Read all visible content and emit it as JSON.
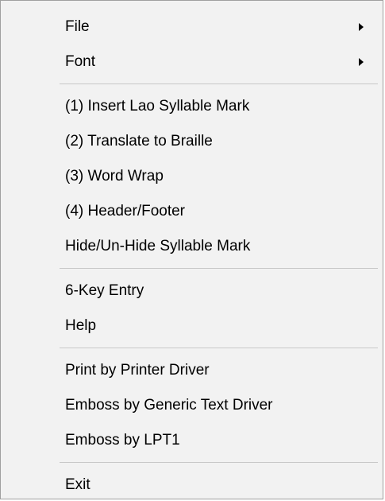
{
  "menu": {
    "file": "File",
    "font": "Font",
    "insert_lao_syllable_mark": "(1) Insert Lao Syllable Mark",
    "translate_to_braille": "(2) Translate to Braille",
    "word_wrap": "(3) Word Wrap",
    "header_footer": "(4) Header/Footer",
    "hide_unhide_syllable_mark": "Hide/Un-Hide Syllable Mark",
    "six_key_entry": "6-Key Entry",
    "help": "Help",
    "print_by_printer_driver": "Print by Printer Driver",
    "emboss_by_generic_text_driver": "Emboss by Generic Text Driver",
    "emboss_by_lpt1": "Emboss by LPT1",
    "exit": "Exit"
  },
  "icons": {
    "submenu_arrow": "chevron-right-icon"
  }
}
